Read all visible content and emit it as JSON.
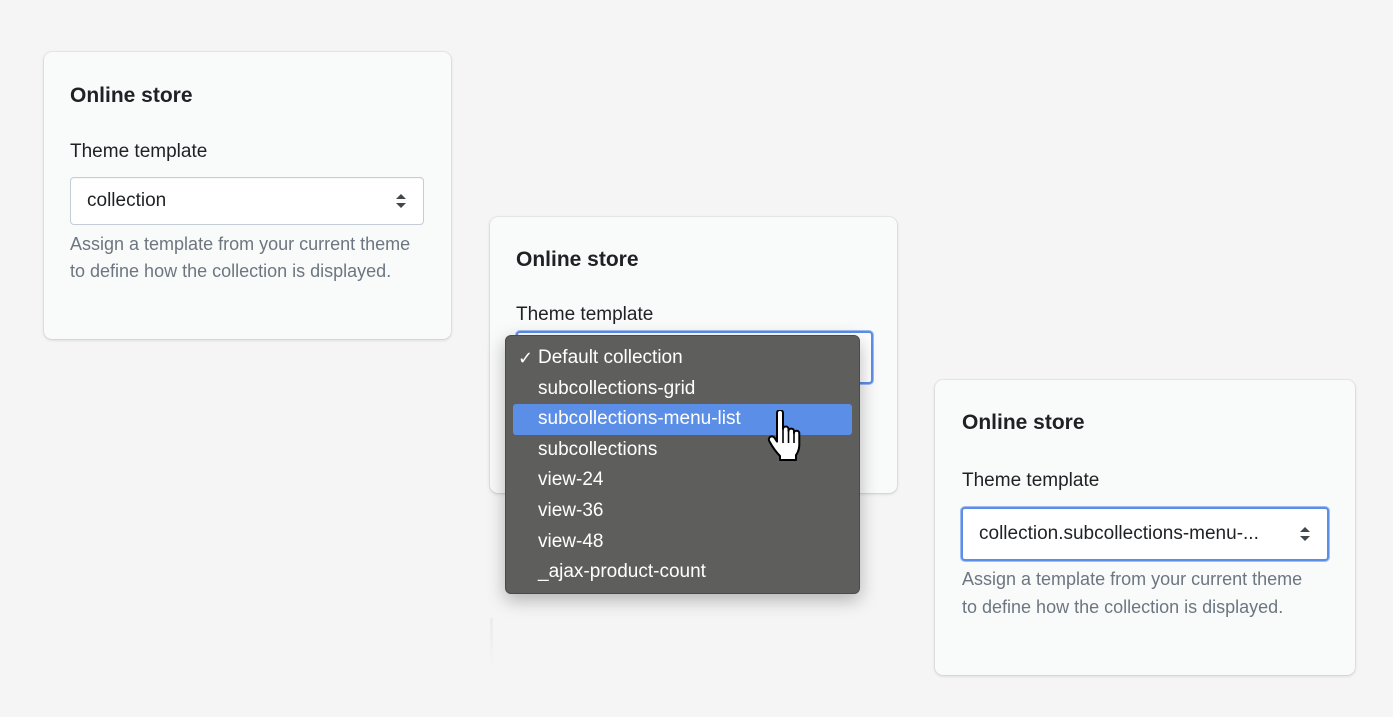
{
  "cards": [
    {
      "title": "Online store",
      "label": "Theme template",
      "select_value": "collection",
      "help_text": "Assign a template from your current theme to define how the collection is displayed."
    },
    {
      "title": "Online store",
      "label": "Theme template",
      "select_value": "",
      "help_text": ""
    },
    {
      "title": "Online store",
      "label": "Theme template",
      "select_value": "collection.subcollections-menu-...",
      "help_text": "Assign a template from your current theme to define how the collection is displayed."
    }
  ],
  "dropdown": {
    "check_mark": "✓",
    "options": [
      "Default collection",
      "subcollections-grid",
      "subcollections-menu-list",
      "subcollections",
      "view-24",
      "view-36",
      "view-48",
      "_ajax-product-count"
    ],
    "selected_option": "Default collection",
    "highlighted_option": "subcollections-menu-list"
  },
  "colors": {
    "background": "#f5f5f5",
    "card": "#f9fafa",
    "focus_border": "#5c8ee8",
    "menu_background": "#5e5f5d",
    "menu_highlight": "#5b8ee6",
    "help_text": "#6d7680"
  },
  "icons": {
    "select_arrows": "select-arrows-icon",
    "pointer": "hand-pointer-icon"
  }
}
